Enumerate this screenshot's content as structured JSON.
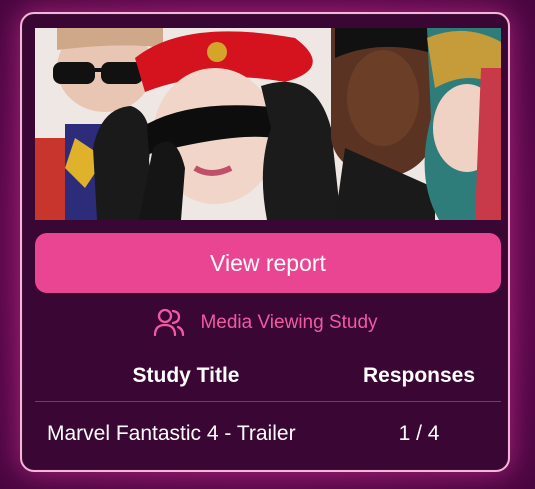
{
  "card": {
    "image": {
      "alt": "four models wearing sunglasses and gloves",
      "icon": "photo"
    },
    "cta_label": "View report",
    "study_type": {
      "icon": "users-icon",
      "label": "Media Viewing Study"
    },
    "table": {
      "headers": [
        "Study Title",
        "Responses"
      ],
      "rows": [
        {
          "title": "Marvel Fantastic 4 - Trailer",
          "responses": "1 / 4"
        }
      ]
    }
  },
  "colors": {
    "accent": "#ea4593",
    "accent_text": "#f05aa3",
    "card_bg": "#3a0634",
    "card_border": "#f4b6d8"
  }
}
